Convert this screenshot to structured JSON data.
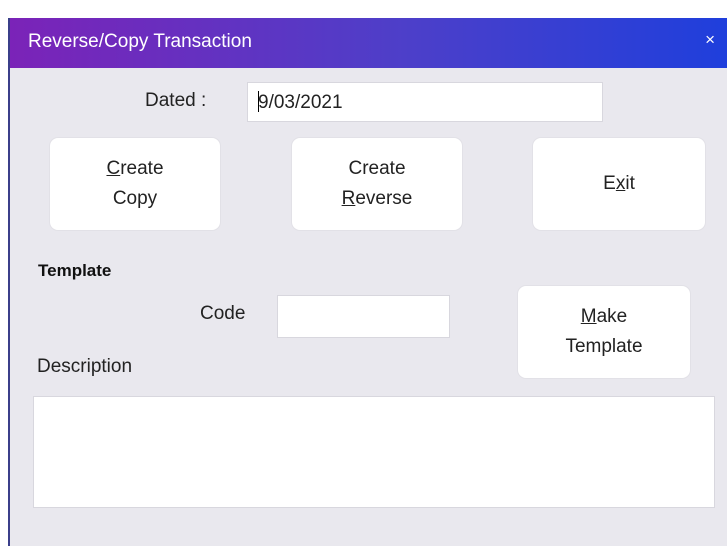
{
  "window": {
    "title": "Reverse/Copy Transaction",
    "close_symbol": "×"
  },
  "dated": {
    "label": "Dated :",
    "value": "9/03/2021"
  },
  "buttons": {
    "create_copy": {
      "line1_key": "C",
      "line1_rest": "reate",
      "line2": "Copy"
    },
    "create_reverse": {
      "line1": "Create",
      "line2_key": "R",
      "line2_rest": "everse"
    },
    "exit": {
      "pre": "E",
      "key": "x",
      "post": "it"
    },
    "make_template": {
      "line1_key": "M",
      "line1_rest": "ake",
      "line2": "Template"
    }
  },
  "template": {
    "heading": "Template",
    "code_label": "Code",
    "code_value": "",
    "description_label": "Description",
    "description_value": ""
  }
}
